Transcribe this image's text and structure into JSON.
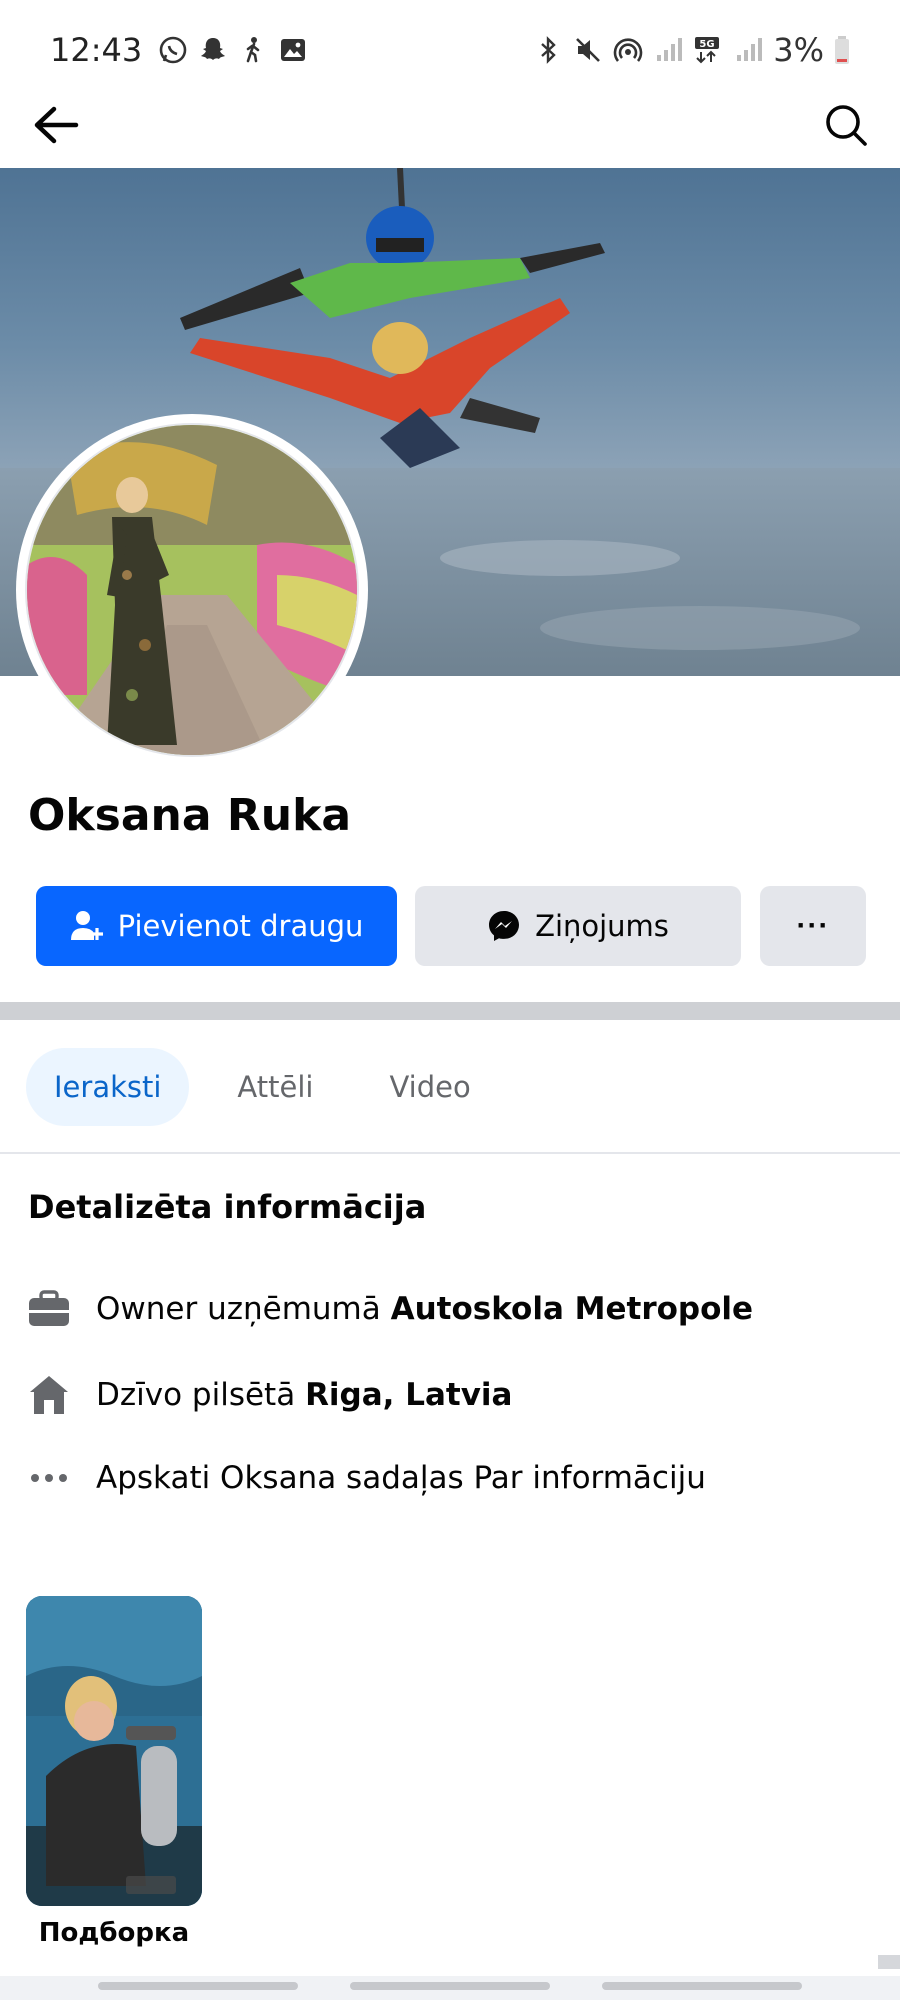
{
  "status_bar": {
    "time": "12:43",
    "left_icons": [
      "whatsapp-icon",
      "snapchat-icon",
      "walking-icon",
      "gallery-icon"
    ],
    "right_icons": [
      "bluetooth-icon",
      "mute-icon",
      "hotspot-icon",
      "signal-icon",
      "5g-signal-icon",
      "signal-icon"
    ],
    "battery": "3%"
  },
  "nav": {
    "back_icon": "arrow-left-icon",
    "search_icon": "search-icon"
  },
  "profile": {
    "name": "Oksana Ruka"
  },
  "actions": {
    "add_friend": "Pievienot draugu",
    "message": "Ziņojums",
    "more": "···"
  },
  "tabs": [
    {
      "label": "Ieraksti",
      "active": true
    },
    {
      "label": "Attēli",
      "active": false
    },
    {
      "label": "Video",
      "active": false
    }
  ],
  "details": {
    "title": "Detalizēta informācija",
    "items": [
      {
        "icon": "briefcase-icon",
        "prefix": "Owner uzņēmumā ",
        "strong": "Autoskola Metropole"
      },
      {
        "icon": "home-icon",
        "prefix": "Dzīvo pilsētā ",
        "strong": "Riga, Latvia"
      },
      {
        "icon": "ellipsis-icon",
        "prefix": "Apskati Oksana sadaļas Par informāciju",
        "strong": ""
      }
    ]
  },
  "collection": {
    "label": "Подборка"
  },
  "colors": {
    "primary": "#0866ff",
    "secondary_bg": "#e4e6eb",
    "active_tab_bg": "#ebf5ff",
    "active_tab_text": "#0a65c9"
  }
}
